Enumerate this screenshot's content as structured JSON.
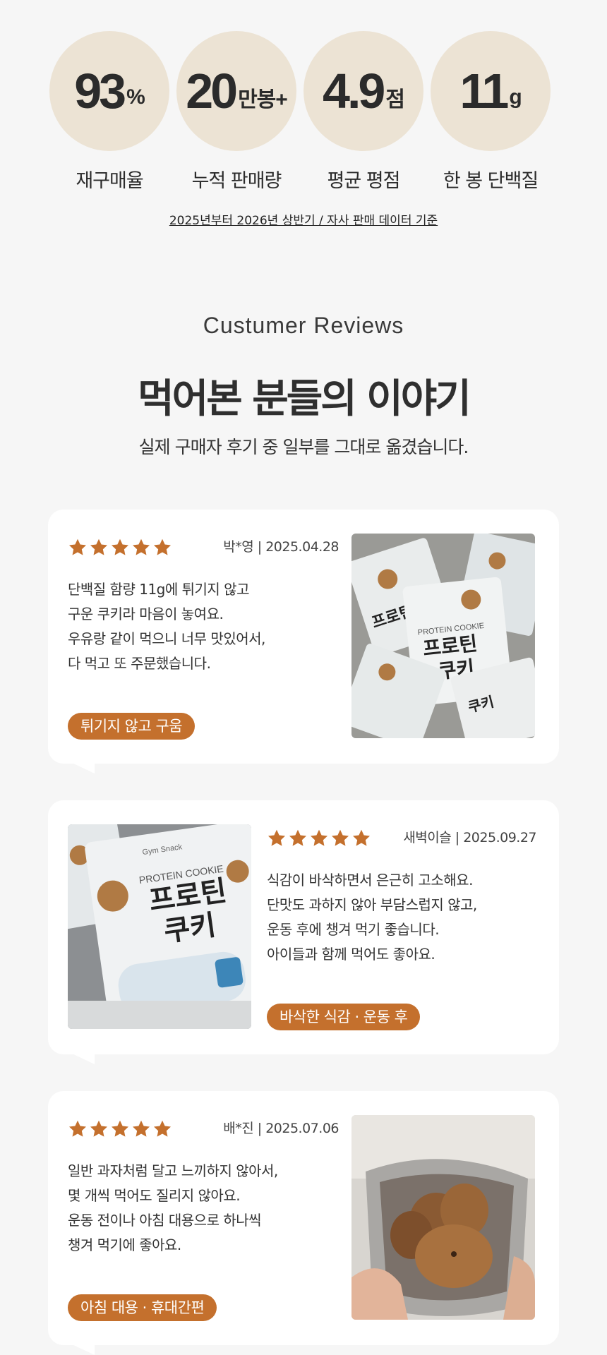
{
  "stats": [
    {
      "value": "93",
      "unit": "%",
      "label": "재구매율"
    },
    {
      "value": "20",
      "unit": "만봉+",
      "label": "누적 판매량"
    },
    {
      "value": "4.9",
      "unit": "점",
      "label": "평균 평점"
    },
    {
      "value": "11",
      "unit": "g",
      "label": "한 봉 단백질"
    }
  ],
  "data_note": "2025년부터 2026년 상반기 / 자사 판매 데이터 기준",
  "section": {
    "subtitle_en": "Custumer Reviews",
    "headline": "먹어본 분들의 이야기",
    "description": "실제 구매자 후기 중 일부를 그대로 옮겼습니다."
  },
  "reviews": [
    {
      "rating": 5,
      "meta": "박*영 | 2025.04.28",
      "lines": [
        "단백질 함량 11g에 튀기지 않고",
        "구운 쿠키라 마음이 놓여요.",
        "우유랑 같이 먹으니 너무 맛있어서,",
        "다 먹고 또 주문했습니다."
      ],
      "tag": "튀기지 않고 구움",
      "photo_icon": "product-pouches-photo"
    },
    {
      "rating": 5,
      "meta": "새벽이슬 | 2025.09.27",
      "lines": [
        "식감이 바삭하면서 은근히 고소해요.",
        "단맛도 과하지 않아 부담스럽지 않고,",
        "운동 후에 챙겨 먹기 좋습니다.",
        "아이들과 함께 먹어도 좋아요."
      ],
      "tag": "바삭한 식감 · 운동 후",
      "photo_icon": "product-pouch-closeup-photo"
    },
    {
      "rating": 5,
      "meta": "배*진 | 2025.07.06",
      "lines": [
        "일반 과자처럼 달고 느끼하지 않아서,",
        "몇 개씩 먹어도 질리지 않아요.",
        "운동 전이나 아침 대용으로 하나씩",
        "챙겨 먹기에 좋아요."
      ],
      "tag": "아침 대용 · 휴대간편",
      "photo_icon": "opened-pouch-cookies-photo"
    }
  ],
  "product": {
    "name_en": "PROTEIN COOKIE",
    "name_ko_1": "프로틴",
    "name_ko_2": "쿠키",
    "brand": "Gym Snack"
  },
  "colors": {
    "accent": "#c4702d",
    "circle": "#ece3d4",
    "background": "#f6f6f6",
    "card": "#ffffff"
  }
}
